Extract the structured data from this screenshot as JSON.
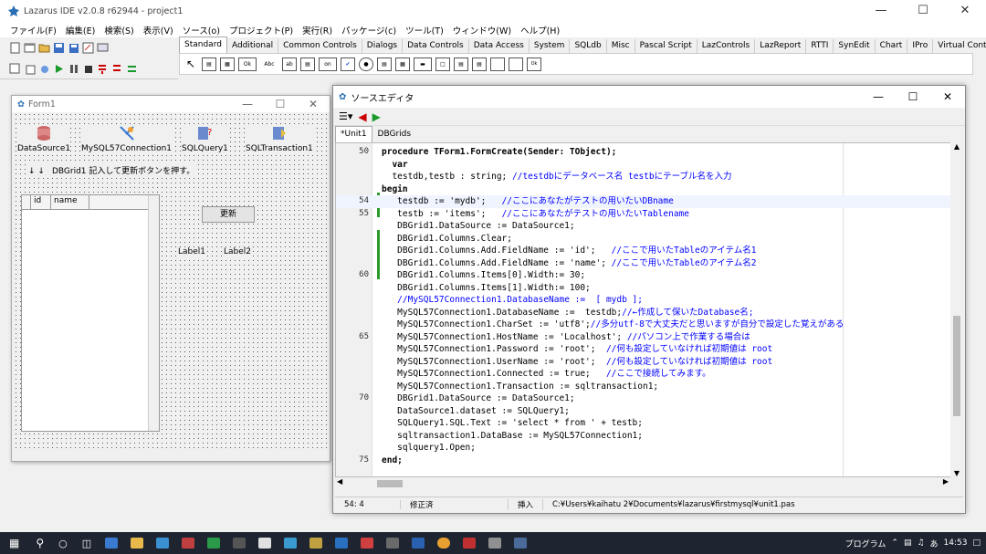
{
  "ide": {
    "title": "Lazarus IDE v2.0.8 r62944 - project1",
    "menu": [
      "ファイル(F)",
      "編集(E)",
      "検索(S)",
      "表示(V)",
      "ソース(o)",
      "プロジェクト(P)",
      "実行(R)",
      "パッケージ(c)",
      "ツール(T)",
      "ウィンドウ(W)",
      "ヘルプ(H)"
    ],
    "component_tabs": [
      "Standard",
      "Additional",
      "Common Controls",
      "Dialogs",
      "Data Controls",
      "Data Access",
      "System",
      "SQLdb",
      "Misc",
      "Pascal Script",
      "LazControls",
      "LazReport",
      "RTTI",
      "SynEdit",
      "Chart",
      "IPro",
      "Virtual Controls"
    ],
    "palette_labels": [
      "Ok",
      "Abc",
      "ab",
      "on"
    ]
  },
  "form1": {
    "title": "Form1",
    "components": [
      "DataSource1",
      "MySQL57Connection1",
      "SQLQuery1",
      "SQLTransaction1"
    ],
    "instruction": "DBGrid1 記入して更新ボタンを押す。",
    "grid_columns": [
      "id",
      "name"
    ],
    "update_button": "更新",
    "label1": "Label1",
    "label2": "Label2"
  },
  "editor": {
    "title": "ソースエディタ",
    "tabs": [
      "*Unit1",
      "DBGrids"
    ],
    "lines": [
      {
        "n": "50",
        "t": "procedure TForm1.FormCreate(Sender: TObject);"
      },
      {
        "n": "",
        "t": "  var"
      },
      {
        "n": "",
        "t": "  testdb,testb : string; //testdbにデータベース名 testbにテーブル名を入力"
      },
      {
        "n": "",
        "t": "begin"
      },
      {
        "n": "54",
        "t": "   testdb := 'mydb';   //ここにあなたがテストの用いたいDBname"
      },
      {
        "n": "55",
        "t": "   testb := 'items';   //ここにあなたがテストの用いたいTablename"
      },
      {
        "n": "",
        "t": "   DBGrid1.DataSource := DataSource1;"
      },
      {
        "n": "",
        "t": "   DBGrid1.Columns.Clear;"
      },
      {
        "n": "",
        "t": "   DBGrid1.Columns.Add.FieldName := 'id';   //ここで用いたTableのアイテム名1"
      },
      {
        "n": "",
        "t": "   DBGrid1.Columns.Add.FieldName := 'name'; //ここで用いたTableのアイテム名2"
      },
      {
        "n": "60",
        "t": "   DBGrid1.Columns.Items[0].Width:= 30;"
      },
      {
        "n": "",
        "t": "   DBGrid1.Columns.Items[1].Width:= 100;"
      },
      {
        "n": "",
        "t": "   //MySQL57Connection1.DatabaseName :=  [ mydb ];"
      },
      {
        "n": "",
        "t": "   MySQL57Connection1.DatabaseName :=  testdb;//←作成して保いたDatabase名;"
      },
      {
        "n": "",
        "t": "   MySQL57Connection1.CharSet := 'utf8';//多分utf-8で大丈夫だと思いますが自分で設定した覚えがある"
      },
      {
        "n": "65",
        "t": "   MySQL57Connection1.HostName := 'Localhost'; //パソコン上で作業する場合は"
      },
      {
        "n": "",
        "t": "   MySQL57Connection1.Password := 'root';  //何も設定していなければ初期値は root"
      },
      {
        "n": "",
        "t": "   MySQL57Connection1.UserName := 'root';  //何も設定していなければ初期値は root"
      },
      {
        "n": "",
        "t": "   MySQL57Connection1.Connected := true;   //ここで接続してみます。"
      },
      {
        "n": "",
        "t": "   MySQL57Connection1.Transaction := sqltransaction1;"
      },
      {
        "n": "70",
        "t": "   DBGrid1.DataSource := DataSource1;"
      },
      {
        "n": "",
        "t": "   DataSource1.dataset := SQLQuery1;"
      },
      {
        "n": "",
        "t": "   SQLQuery1.SQL.Text := 'select * from ' + testb;"
      },
      {
        "n": "",
        "t": "   sqltransaction1.DataBase := MySQL57Connection1;"
      },
      {
        "n": "",
        "t": "   sqlquery1.Open;"
      },
      {
        "n": "75",
        "t": "end;"
      }
    ],
    "status": {
      "position": "54: 4",
      "modified": "修正済",
      "mode": "挿入",
      "path": "C:¥Users¥kaihatu 2¥Documents¥lazarus¥firstmysql¥unit1.pas"
    }
  },
  "taskbar": {
    "tray_label": "プログラム",
    "ime": "あ",
    "time": "14:53"
  },
  "colors": {
    "comment": "#0000ff",
    "highlight": "#c0d8f0",
    "taskbar": "#1e2530"
  }
}
